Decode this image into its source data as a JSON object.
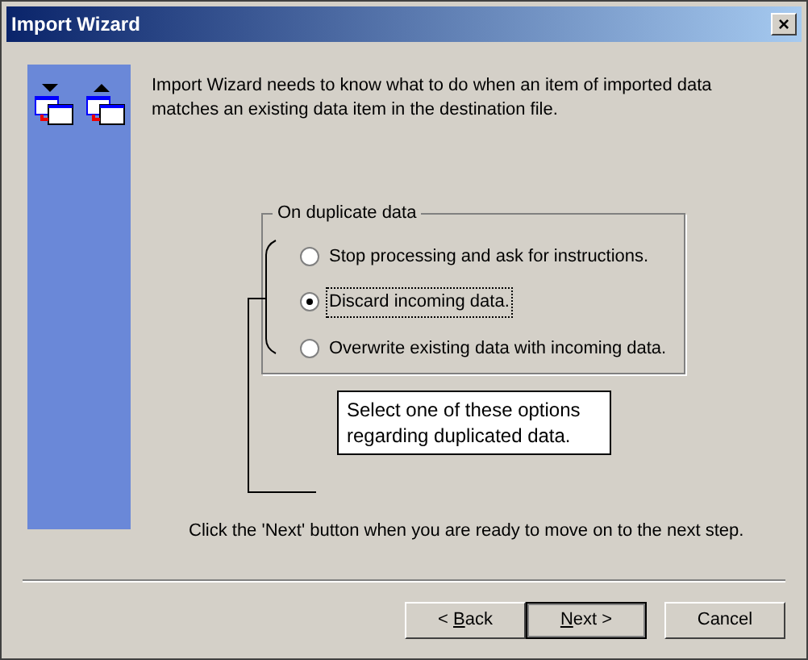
{
  "window": {
    "title": "Import Wizard",
    "close": "×"
  },
  "intro": "Import Wizard needs to know what to do when an item of imported data matches an existing data item in the destination file.",
  "group": {
    "title": "On duplicate data",
    "options": [
      {
        "label": "Stop processing and ask for instructions.",
        "selected": false
      },
      {
        "label": "Discard incoming data.",
        "selected": true
      },
      {
        "label": "Overwrite existing data with incoming data.",
        "selected": false
      }
    ]
  },
  "callout": "Select one of these options regarding duplicated data.",
  "footer_hint": "Click the 'Next' button when you are ready to move on to the next step.",
  "buttons": [
    {
      "before": "< ",
      "key": "B",
      "after": "ack",
      "default": false
    },
    {
      "key": "N",
      "after": "ext >",
      "default": true
    },
    {
      "before": "Cancel",
      "default": false
    }
  ]
}
